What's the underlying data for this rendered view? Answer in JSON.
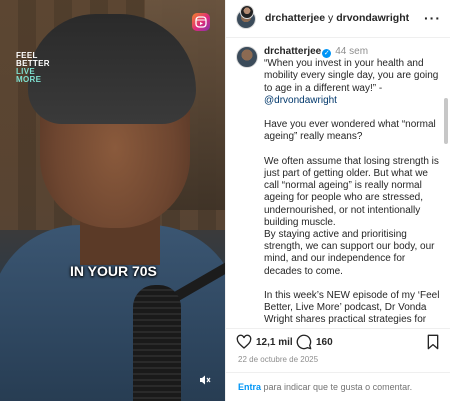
{
  "media": {
    "logo_lines": [
      "FEEL",
      "BETTER",
      "LIVE",
      "MORE"
    ],
    "caption_overlay": "IN YOUR 70S"
  },
  "header": {
    "user1": "drchatterjee",
    "conjunction": "y",
    "user2": "drvondawright",
    "more": "···"
  },
  "comment": {
    "username": "drchatterjee",
    "verified_mark": "✓",
    "time": "44 sem",
    "paragraphs": [
      "“When you invest in your health and mobility every single day, you are going to age in a different way!” -",
      "@drvondawright",
      "",
      "Have you ever wondered what “normal ageing” really means?",
      "",
      "We often assume that losing strength is just part of getting older. But what we call “normal ageing” is really normal ageing for people who are stressed, undernourished, or not intentionally building muscle.",
      "By staying active and prioritising strength, we can support our body, our mind, and our independence for decades to come.",
      "",
      "In this week’s NEW episode of my ‘Feel Better, Live More’ podcast, Dr Vonda Wright shares practical strategies for"
    ]
  },
  "actions": {
    "likes": "12,1 mil",
    "comments": "160"
  },
  "date": "22 de octubre de 2025",
  "add_comment": {
    "link": "Entra",
    "rest": " para indicar que te gusta o comentar."
  },
  "colors": {
    "link_blue": "#0095f6",
    "mention": "#00376b",
    "muted": "#8e8e8e"
  },
  "icons": [
    "reels-icon",
    "mute-icon",
    "heart-icon",
    "comment-icon",
    "bookmark-icon",
    "verified-icon",
    "more-icon"
  ]
}
